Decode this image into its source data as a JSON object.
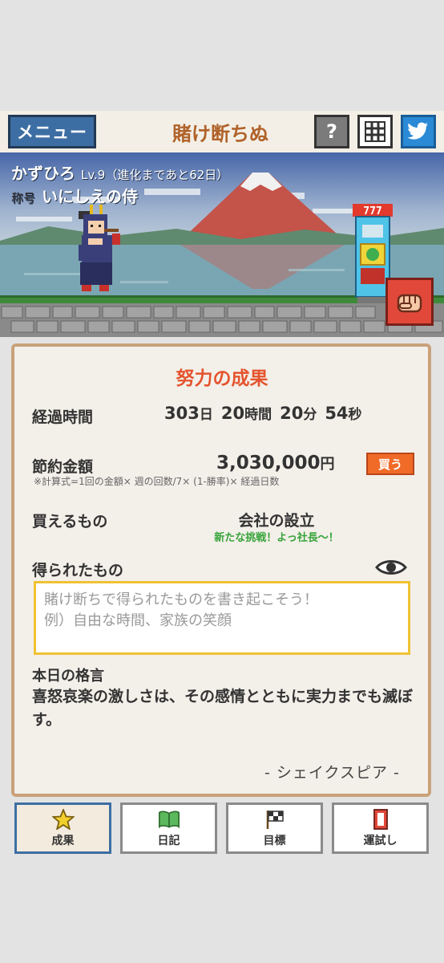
{
  "header": {
    "menu_label": "メニュー",
    "app_title": "賭け断ちぬ",
    "help_label": "?"
  },
  "character": {
    "name": "かずひろ",
    "level": "Lv.9",
    "evolution": "（進化まであと62日）",
    "title_label": "称号",
    "title_value": "いにしえの侍"
  },
  "card": {
    "title": "努力の成果",
    "elapsed_label": "経過時間",
    "elapsed": {
      "days": "303",
      "days_unit": "日",
      "hours": "20",
      "hours_unit": "時間",
      "minutes": "20",
      "minutes_unit": "分",
      "seconds": "54",
      "seconds_unit": "秒"
    },
    "saving_label": "節約金額",
    "saving_value": "3,030,000",
    "saving_unit": "円",
    "buy_button": "買う",
    "formula": "※計算式=1回の金額× 週の回数/7× (1-勝率)× 経過日数",
    "buyable_label": "買えるもの",
    "buyable_item": "会社の設立",
    "buyable_sub": "新たな挑戦！よっ社長〜！",
    "gained_label": "得られたもの",
    "gained_placeholder": "賭け断ちで得られたものを書き起こそう！\n例）自由な時間、家族の笑顔",
    "quote_label": "本日の格言",
    "quote_text": "喜怒哀楽の激しさは、その感情とともに実力までも滅ぼす。",
    "quote_author": "- シェイクスピア -"
  },
  "tabs": [
    {
      "label": "成果",
      "icon": "star-icon"
    },
    {
      "label": "日記",
      "icon": "book-icon"
    },
    {
      "label": "目標",
      "icon": "flag-icon"
    },
    {
      "label": "運試し",
      "icon": "card-icon"
    }
  ],
  "colors": {
    "accent_orange": "#e4542e",
    "menu_blue": "#3d6ea3",
    "buy_orange": "#f06b28",
    "green_text": "#36a43a",
    "card_border": "#c9a27a"
  }
}
